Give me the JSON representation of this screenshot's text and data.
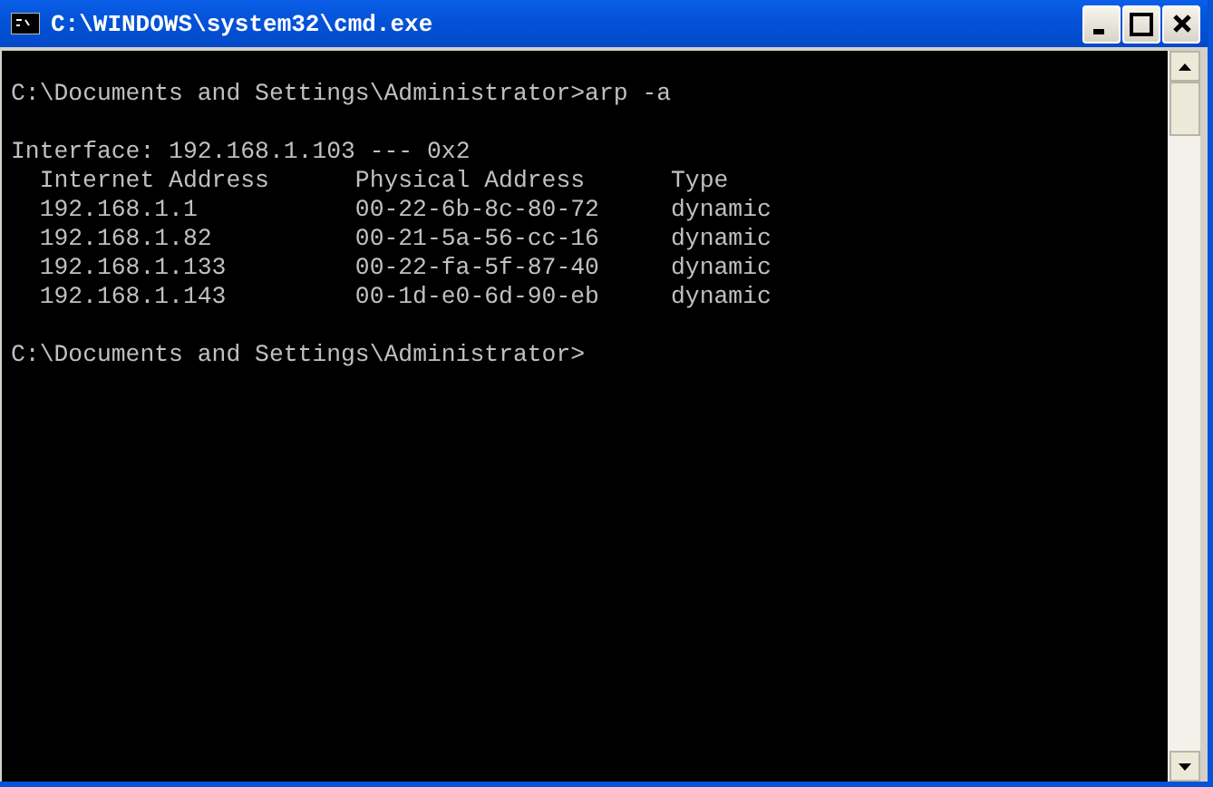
{
  "window": {
    "title": "C:\\WINDOWS\\system32\\cmd.exe"
  },
  "console": {
    "command_line": "C:\\Documents and Settings\\Administrator>arp -a",
    "interface_line": "Interface: 192.168.1.103 --- 0x2",
    "table": {
      "columns": [
        "Internet Address",
        "Physical Address",
        "Type"
      ],
      "rows": [
        [
          "192.168.1.1",
          "00-22-6b-8c-80-72",
          "dynamic"
        ],
        [
          "192.168.1.82",
          "00-21-5a-56-cc-16",
          "dynamic"
        ],
        [
          "192.168.1.133",
          "00-22-fa-5f-87-40",
          "dynamic"
        ],
        [
          "192.168.1.143",
          "00-1d-e0-6d-90-eb",
          "dynamic"
        ]
      ]
    },
    "prompt_line": "C:\\Documents and Settings\\Administrator>"
  }
}
